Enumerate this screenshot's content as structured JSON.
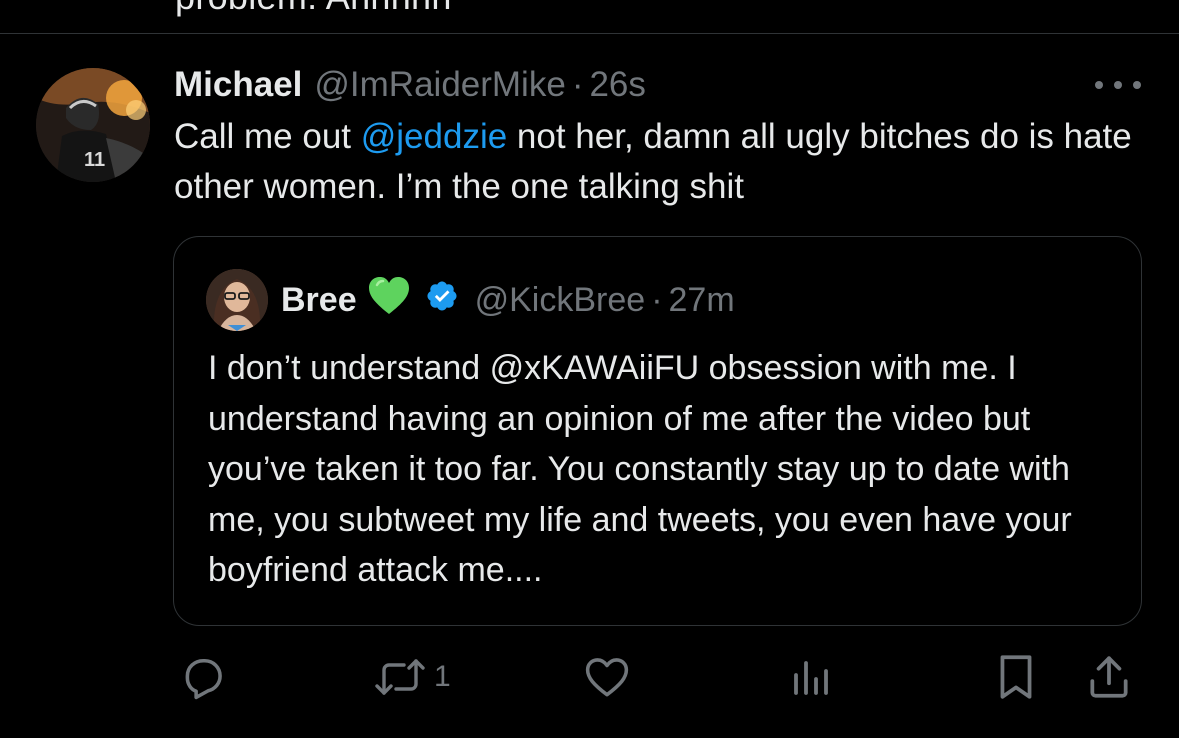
{
  "previous_tweet": {
    "fragment": "problem. Ahhhhh"
  },
  "tweet": {
    "display_name": "Michael",
    "handle": "@ImRaiderMike",
    "separator": "·",
    "time": "26s",
    "text_before_mention": "Call me out ",
    "mention": "@jeddzie",
    "text_after_mention": " not her, damn all ugly bitches do is hate other women. I’m the one talking shit"
  },
  "quoted_tweet": {
    "display_name": "Bree",
    "handle": "@KickBree",
    "separator": "·",
    "time": "27m",
    "text": "I don’t understand @xKAWAiiFU obsession with me. I understand having an opinion of me after the video but you’ve taken it too far. You constantly stay up to date with me, you subtweet my life and tweets, you even have your boyfriend attack me...."
  },
  "actions": {
    "reply_count": "",
    "retweet_count": "1",
    "like_count": "",
    "views_count": ""
  },
  "icons": {
    "more": "more-horizontal-icon",
    "reply": "reply-icon",
    "retweet": "retweet-icon",
    "like": "heart-icon",
    "views": "views-icon",
    "bookmark": "bookmark-icon",
    "share": "share-icon",
    "verified": "verified-badge-icon",
    "heart_emoji": "green-heart-icon"
  },
  "colors": {
    "background": "#000000",
    "text": "#e7e9ea",
    "secondary": "#71767b",
    "link": "#1d9bf0",
    "border": "#2f3336",
    "verified": "#1d9bf0",
    "green_heart": "#5ed35e"
  }
}
